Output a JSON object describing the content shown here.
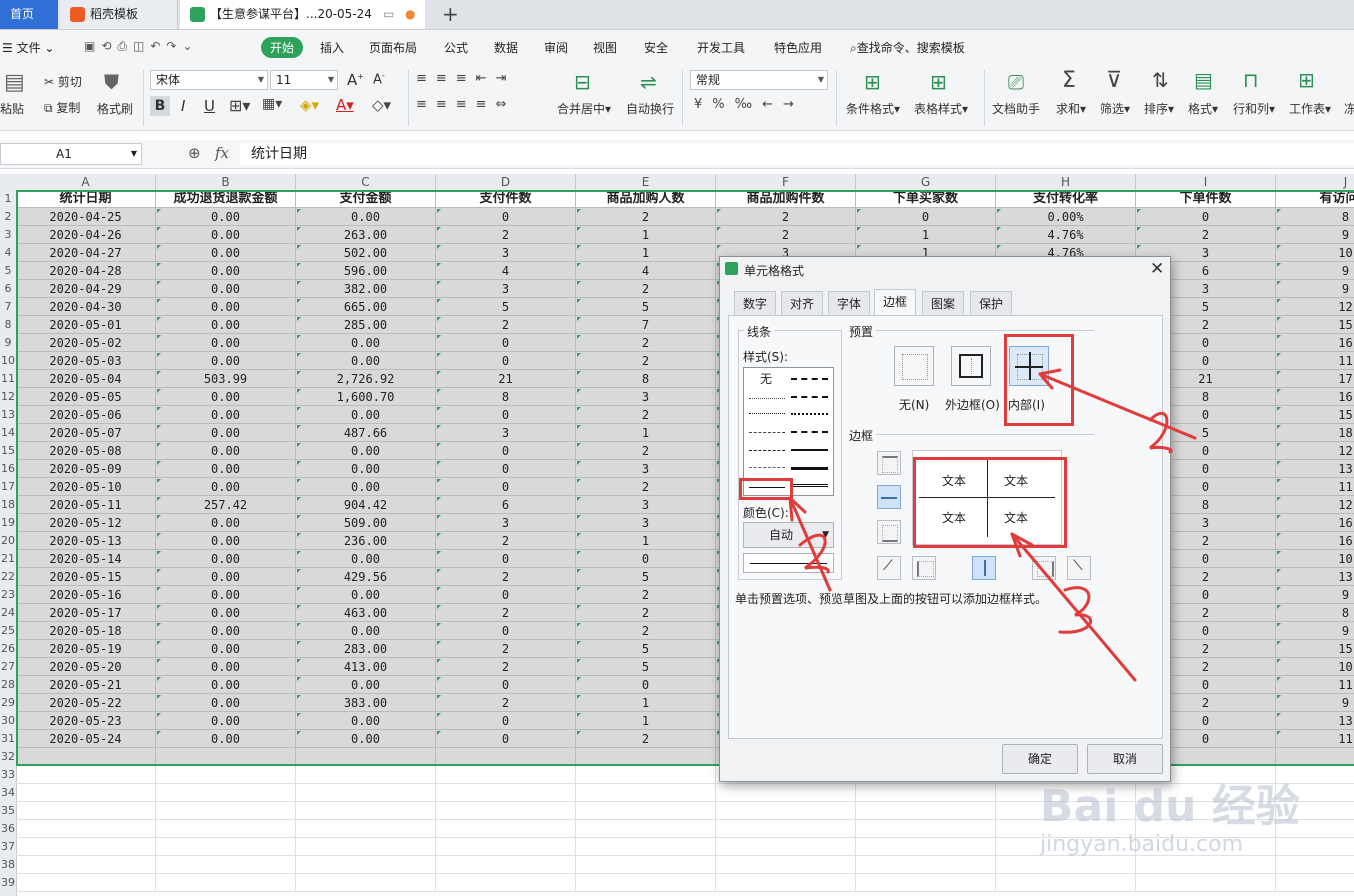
{
  "tabs": {
    "home": "首页",
    "daoke": "稻壳模板",
    "doc": "【生意参谋平台】...20-05-24"
  },
  "menu": {
    "file": "文件",
    "start": "开始",
    "insert": "插入",
    "layout": "页面布局",
    "formula": "公式",
    "data": "数据",
    "review": "审阅",
    "view": "视图",
    "security": "安全",
    "dev": "开发工具",
    "special": "特色应用",
    "search": "查找命令、搜索模板"
  },
  "ribbon": {
    "paste": "粘贴",
    "cut": "剪切",
    "copy": "复制",
    "format_painter": "格式刷",
    "font_name": "宋体",
    "font_size": "11",
    "bold": "B",
    "italic": "I",
    "underline": "U",
    "merge": "合并居中",
    "wrap": "自动换行",
    "num_format": "常规",
    "cond_format": "条件格式",
    "table_style": "表格样式",
    "doc_helper": "文档助手",
    "sum": "求和",
    "filter": "筛选",
    "sort": "排序",
    "format": "格式",
    "rowcol": "行和列",
    "sheet": "工作表",
    "float": "冻"
  },
  "formula_bar": {
    "cell_ref": "A1",
    "fx": "fx",
    "content": "统计日期"
  },
  "columns": [
    "A",
    "B",
    "C",
    "D",
    "E",
    "F",
    "G",
    "H",
    "I",
    "J"
  ],
  "headers": [
    "统计日期",
    "成功退货退款金额",
    "支付金额",
    "支付件数",
    "商品加购人数",
    "商品加购件数",
    "下单买家数",
    "支付转化率",
    "下单件数",
    "有访问商"
  ],
  "rows": [
    [
      "2020-04-25",
      "0.00",
      "0.00",
      "0",
      "2",
      "2",
      "0",
      "0.00%",
      "0",
      "8"
    ],
    [
      "2020-04-26",
      "0.00",
      "263.00",
      "2",
      "1",
      "2",
      "1",
      "4.76%",
      "2",
      "9"
    ],
    [
      "2020-04-27",
      "0.00",
      "502.00",
      "3",
      "1",
      "3",
      "1",
      "4.76%",
      "3",
      "10"
    ],
    [
      "2020-04-28",
      "0.00",
      "596.00",
      "4",
      "4",
      "",
      "",
      "",
      "6",
      "9"
    ],
    [
      "2020-04-29",
      "0.00",
      "382.00",
      "3",
      "2",
      "",
      "",
      "",
      "3",
      "9"
    ],
    [
      "2020-04-30",
      "0.00",
      "665.00",
      "5",
      "5",
      "",
      "",
      "",
      "5",
      "12"
    ],
    [
      "2020-05-01",
      "0.00",
      "285.00",
      "2",
      "7",
      "",
      "",
      "",
      "2",
      "15"
    ],
    [
      "2020-05-02",
      "0.00",
      "0.00",
      "0",
      "2",
      "",
      "",
      "",
      "0",
      "16"
    ],
    [
      "2020-05-03",
      "0.00",
      "0.00",
      "0",
      "2",
      "",
      "",
      "",
      "0",
      "11"
    ],
    [
      "2020-05-04",
      "503.99",
      "2,726.92",
      "21",
      "8",
      "",
      "",
      "",
      "21",
      "17"
    ],
    [
      "2020-05-05",
      "0.00",
      "1,600.70",
      "8",
      "3",
      "",
      "",
      "",
      "8",
      "16"
    ],
    [
      "2020-05-06",
      "0.00",
      "0.00",
      "0",
      "2",
      "",
      "",
      "",
      "0",
      "15"
    ],
    [
      "2020-05-07",
      "0.00",
      "487.66",
      "3",
      "1",
      "",
      "",
      "",
      "5",
      "18"
    ],
    [
      "2020-05-08",
      "0.00",
      "0.00",
      "0",
      "2",
      "",
      "",
      "",
      "0",
      "12"
    ],
    [
      "2020-05-09",
      "0.00",
      "0.00",
      "0",
      "3",
      "",
      "",
      "",
      "0",
      "13"
    ],
    [
      "2020-05-10",
      "0.00",
      "0.00",
      "0",
      "2",
      "",
      "",
      "",
      "0",
      "11"
    ],
    [
      "2020-05-11",
      "257.42",
      "904.42",
      "6",
      "3",
      "",
      "",
      "",
      "8",
      "12"
    ],
    [
      "2020-05-12",
      "0.00",
      "509.00",
      "3",
      "3",
      "",
      "",
      "",
      "3",
      "16"
    ],
    [
      "2020-05-13",
      "0.00",
      "236.00",
      "2",
      "1",
      "",
      "",
      "",
      "2",
      "16"
    ],
    [
      "2020-05-14",
      "0.00",
      "0.00",
      "0",
      "0",
      "",
      "",
      "",
      "0",
      "10"
    ],
    [
      "2020-05-15",
      "0.00",
      "429.56",
      "2",
      "5",
      "",
      "",
      "",
      "2",
      "13"
    ],
    [
      "2020-05-16",
      "0.00",
      "0.00",
      "0",
      "2",
      "",
      "",
      "",
      "0",
      "9"
    ],
    [
      "2020-05-17",
      "0.00",
      "463.00",
      "2",
      "2",
      "",
      "",
      "",
      "2",
      "8"
    ],
    [
      "2020-05-18",
      "0.00",
      "0.00",
      "0",
      "2",
      "",
      "",
      "",
      "0",
      "9"
    ],
    [
      "2020-05-19",
      "0.00",
      "283.00",
      "2",
      "5",
      "",
      "",
      "",
      "2",
      "15"
    ],
    [
      "2020-05-20",
      "0.00",
      "413.00",
      "2",
      "5",
      "",
      "",
      "",
      "2",
      "10"
    ],
    [
      "2020-05-21",
      "0.00",
      "0.00",
      "0",
      "0",
      "",
      "",
      "",
      "0",
      "11"
    ],
    [
      "2020-05-22",
      "0.00",
      "383.00",
      "2",
      "1",
      "",
      "",
      "",
      "2",
      "9"
    ],
    [
      "2020-05-23",
      "0.00",
      "0.00",
      "0",
      "1",
      "",
      "",
      "",
      "0",
      "13"
    ],
    [
      "2020-05-24",
      "0.00",
      "0.00",
      "0",
      "2",
      "",
      "",
      "",
      "0",
      "11"
    ]
  ],
  "row_numbers": [
    "1",
    "2",
    "3",
    "4",
    "5",
    "6",
    "7",
    "8",
    "9",
    "10",
    "11",
    "12",
    "13",
    "14",
    "15",
    "16",
    "17",
    "18",
    "19",
    "20",
    "21",
    "22",
    "23",
    "24",
    "25",
    "26",
    "27",
    "28",
    "29",
    "30",
    "31",
    "32",
    "33",
    "34",
    "35",
    "36",
    "37",
    "38",
    "39"
  ],
  "dialog": {
    "title": "单元格格式",
    "tabs": [
      "数字",
      "对齐",
      "字体",
      "边框",
      "图案",
      "保护"
    ],
    "line_group": "线条",
    "style_label": "样式(S):",
    "style_none": "无",
    "color_label": "颜色(C):",
    "color_value": "自动",
    "preset_group": "预置",
    "preset_none": "无(N)",
    "preset_outline": "外边框(O)",
    "preset_inside": "内部(I)",
    "border_group": "边框",
    "preview_text": "文本",
    "hint": "单击预置选项、预览草图及上面的按钮可以添加边框样式。",
    "ok": "确定",
    "cancel": "取消"
  },
  "watermark": {
    "brand": "Bai du 经验",
    "url": "jingyan.baidu.com"
  },
  "colors": {
    "accent_green": "#2ea15b",
    "tab_blue": "#2f6fd6",
    "annotation_red": "#e23b3b",
    "cell_fill": "#d9d9d9"
  }
}
